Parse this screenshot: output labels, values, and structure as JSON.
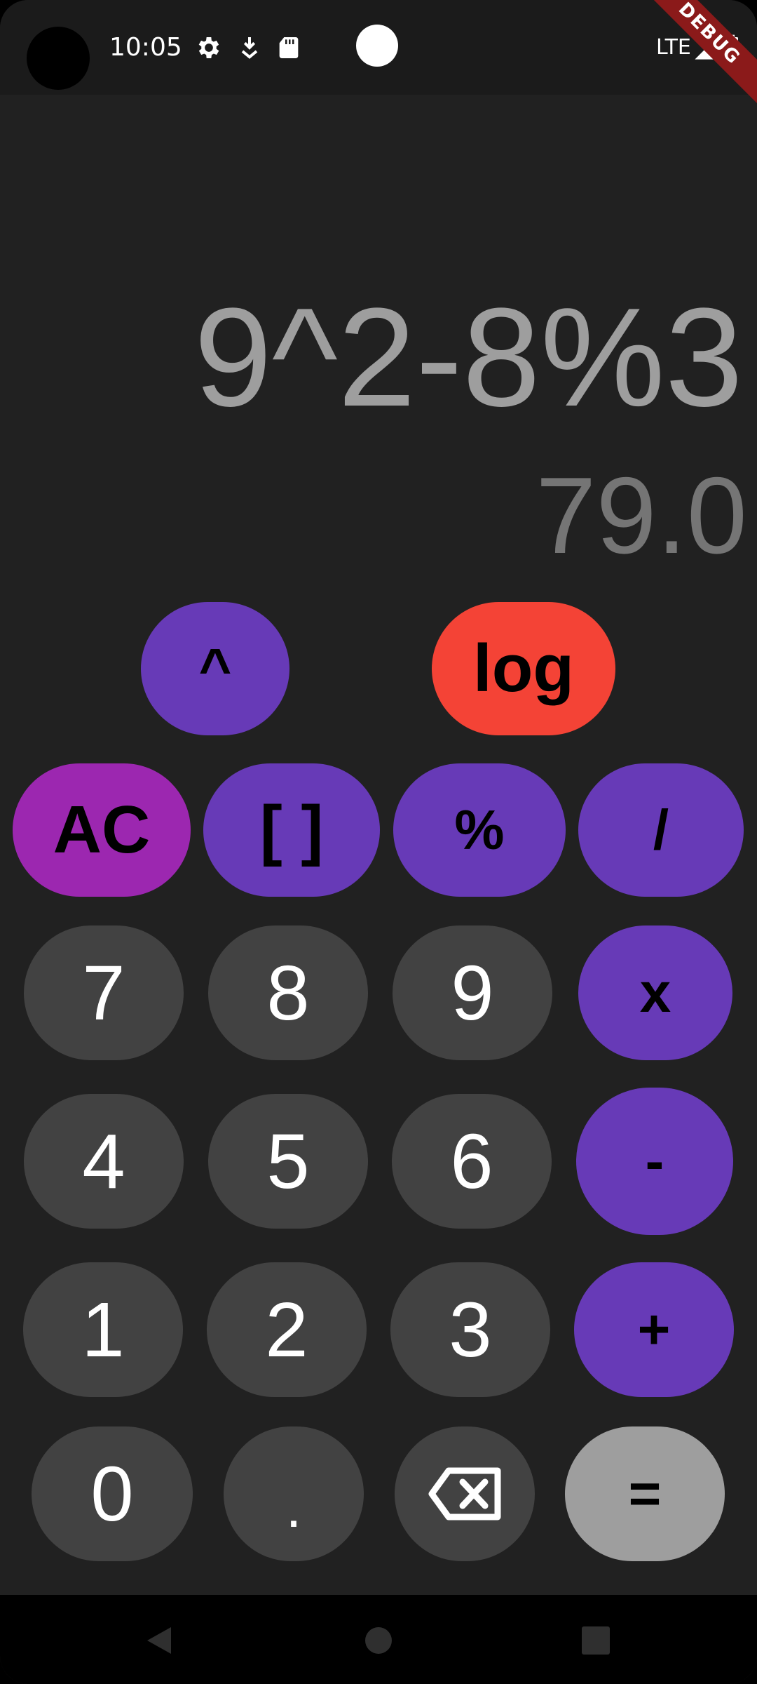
{
  "status_bar": {
    "time": "10:05",
    "network": "LTE",
    "debug_label": "DEBUG",
    "icons": [
      "gear-icon",
      "download-icon",
      "sd-card-icon",
      "signal-icon",
      "battery-icon"
    ]
  },
  "display": {
    "expression": "9^2-8%3",
    "result": "79.0"
  },
  "keypad": {
    "power": "^",
    "log": "log",
    "clear": "AC",
    "brackets": "[ ]",
    "percent": "%",
    "divide": "/",
    "seven": "7",
    "eight": "8",
    "nine": "9",
    "multiply": "x",
    "four": "4",
    "five": "5",
    "six": "6",
    "minus": "-",
    "one": "1",
    "two": "2",
    "three": "3",
    "plus": "+",
    "zero": "0",
    "dot": ".",
    "equals": "="
  },
  "colors": {
    "background": "#212121",
    "number_key": "#424242",
    "operator_key": "#673ab7",
    "clear_key": "#9c27b0",
    "log_key": "#f44336",
    "equals_key": "#9e9e9e",
    "expression_text": "#9e9e9e",
    "result_text": "#757575"
  }
}
